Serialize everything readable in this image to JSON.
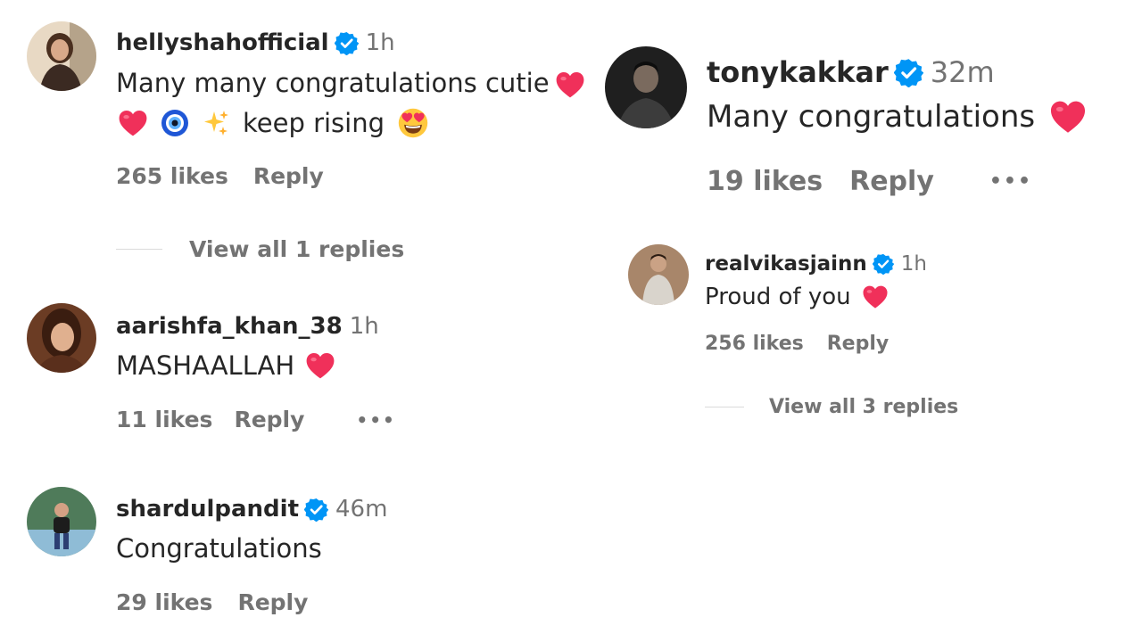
{
  "colors": {
    "verified": "#0095f6",
    "heart": "#ff3040",
    "secondary_text": "#737373",
    "primary_text": "#262626"
  },
  "comments": [
    {
      "username": "hellyshahofficial",
      "verified": true,
      "time": "1h",
      "text_line1": "Many many congratulations cutie",
      "text_line2": "keep rising",
      "emojis": [
        "red-heart",
        "red-heart",
        "nazar-amulet",
        "sparkles",
        "heart-eyes-face"
      ],
      "likes": "265 likes",
      "reply": "Reply",
      "view_replies": "View all 1 replies"
    },
    {
      "username": "aarishfa_khan_38",
      "verified": false,
      "time": "1h",
      "text": "MASHAALLAH",
      "emojis": [
        "red-heart"
      ],
      "likes": "11 likes",
      "reply": "Reply",
      "more": "•••"
    },
    {
      "username": "shardulpandit",
      "verified": true,
      "time": "46m",
      "text": "Congratulations",
      "likes": "29 likes",
      "reply": "Reply"
    },
    {
      "username": "tonykakkar",
      "verified": true,
      "time": "32m",
      "text": "Many congratulations",
      "emojis": [
        "red-heart"
      ],
      "likes": "19 likes",
      "reply": "Reply",
      "more": "•••"
    },
    {
      "username": "realvikasjainn",
      "verified": true,
      "time": "1h",
      "text": "Proud of you",
      "emojis": [
        "red-heart"
      ],
      "likes": "256 likes",
      "reply": "Reply",
      "view_replies": "View all 3 replies"
    }
  ]
}
